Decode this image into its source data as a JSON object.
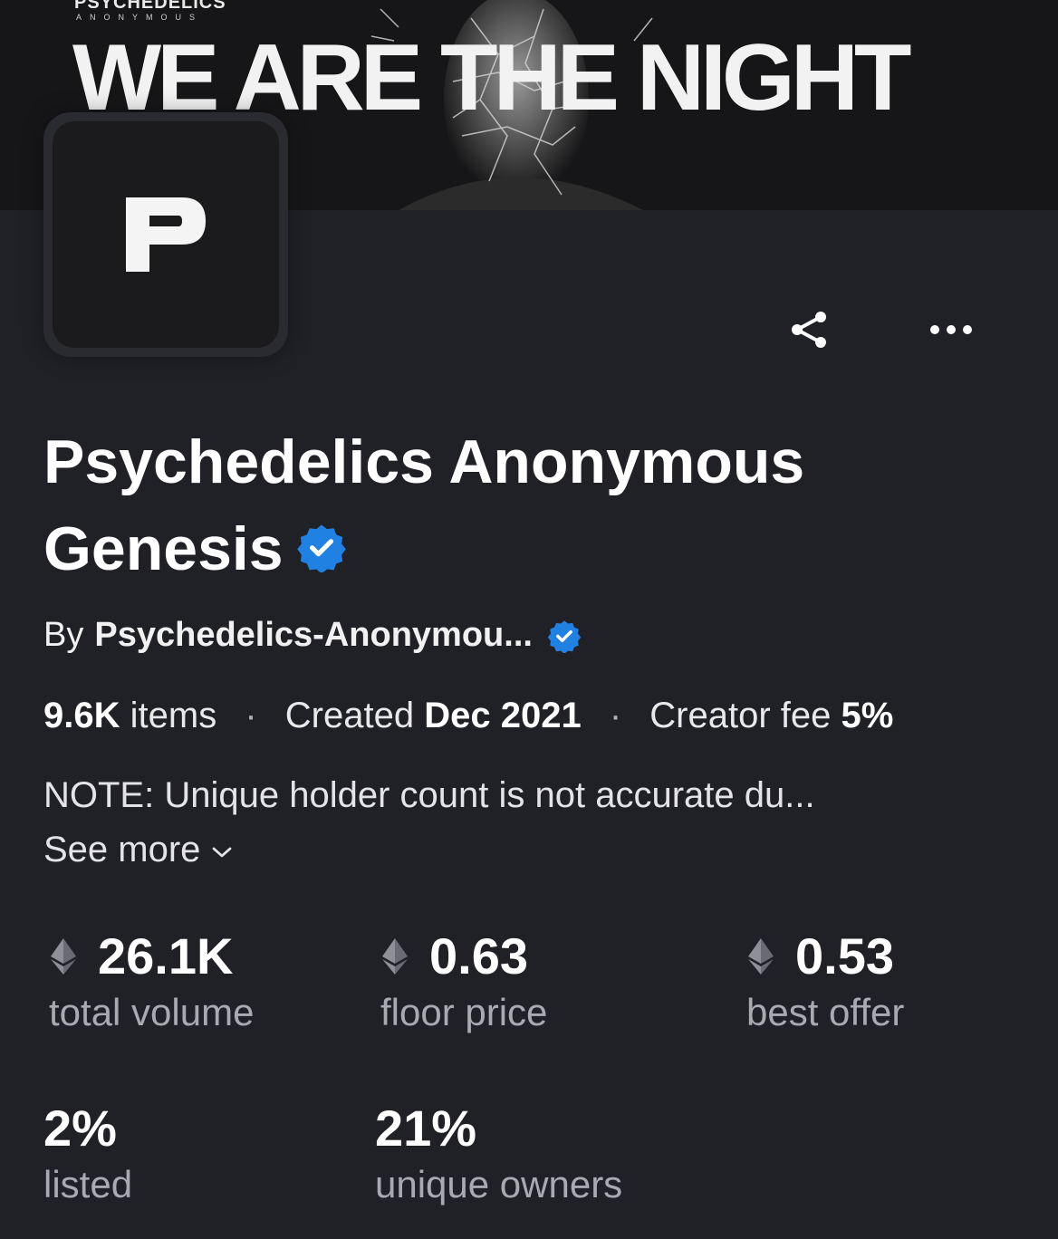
{
  "banner": {
    "brand": "PSYCHEDELICS",
    "brand_sub": "ANONYMOUS",
    "headline": "WE ARE THE NIGHT"
  },
  "collection": {
    "avatar_letter": "P",
    "title": "Psychedelics Anonymous Genesis",
    "by_label": "By",
    "creator": "Psychedelics-Anonymou...",
    "items_value": "9.6K",
    "items_label": "items",
    "created_label": "Created",
    "created_value": "Dec 2021",
    "fee_label": "Creator fee",
    "fee_value": "5%",
    "description": "NOTE: Unique holder count is not accurate du...",
    "see_more": "See more"
  },
  "stats": [
    {
      "value": "26.1K",
      "label": "total volume",
      "icon": "eth-icon"
    },
    {
      "value": "0.63",
      "label": "floor price",
      "icon": "eth-icon"
    },
    {
      "value": "0.53",
      "label": "best offer",
      "icon": "eth-icon"
    },
    {
      "value": "2%",
      "label": "listed"
    },
    {
      "value": "21%",
      "label": "unique owners"
    }
  ],
  "colors": {
    "background": "#202127",
    "verified": "#2081e2",
    "muted_text": "#a9aab1"
  }
}
